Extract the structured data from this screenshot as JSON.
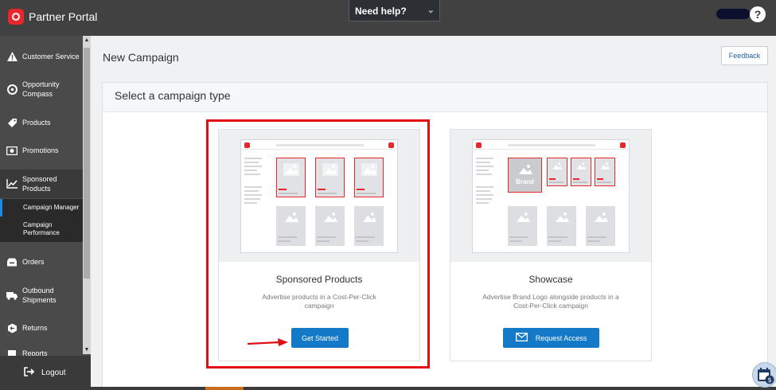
{
  "topbar": {
    "brand_name": "Partner Portal",
    "help_label": "Need help?",
    "help_glyph": "?"
  },
  "sidebar": {
    "items": [
      {
        "label": "Customer Service",
        "icon": "warning-icon"
      },
      {
        "label": "Opportunity Compass",
        "icon": "compass-icon"
      },
      {
        "label": "Products",
        "icon": "tag-icon"
      },
      {
        "label": "Promotions",
        "icon": "promotions-icon"
      },
      {
        "label": "Sponsored Products",
        "icon": "chart-line-icon"
      },
      {
        "label": "Orders",
        "icon": "orders-icon"
      },
      {
        "label": "Outbound Shipments",
        "icon": "truck-icon"
      },
      {
        "label": "Returns",
        "icon": "returns-icon"
      },
      {
        "label": "Reports",
        "icon": "reports-icon"
      }
    ],
    "subitems": [
      {
        "label": "Campaign Manager"
      },
      {
        "label": "Campaign Performance"
      }
    ],
    "logout_label": "Logout"
  },
  "main": {
    "page_title": "New Campaign",
    "feedback_label": "Feedback",
    "section_title": "Select a campaign type",
    "cards": [
      {
        "title": "Sponsored Products",
        "description": "Advertise products in a Cost-Per-Click campaign",
        "button_label": "Get Started"
      },
      {
        "title": "Showcase",
        "description": "Advertise Brand Logo alongside products in a Cost-Per-Click campaign",
        "button_label": "Request Access",
        "brand_tile_label": "Brand"
      }
    ]
  },
  "colors": {
    "accent_blue": "#1479c6",
    "brand_red": "#e8262b",
    "highlight_red": "#e30e14"
  }
}
